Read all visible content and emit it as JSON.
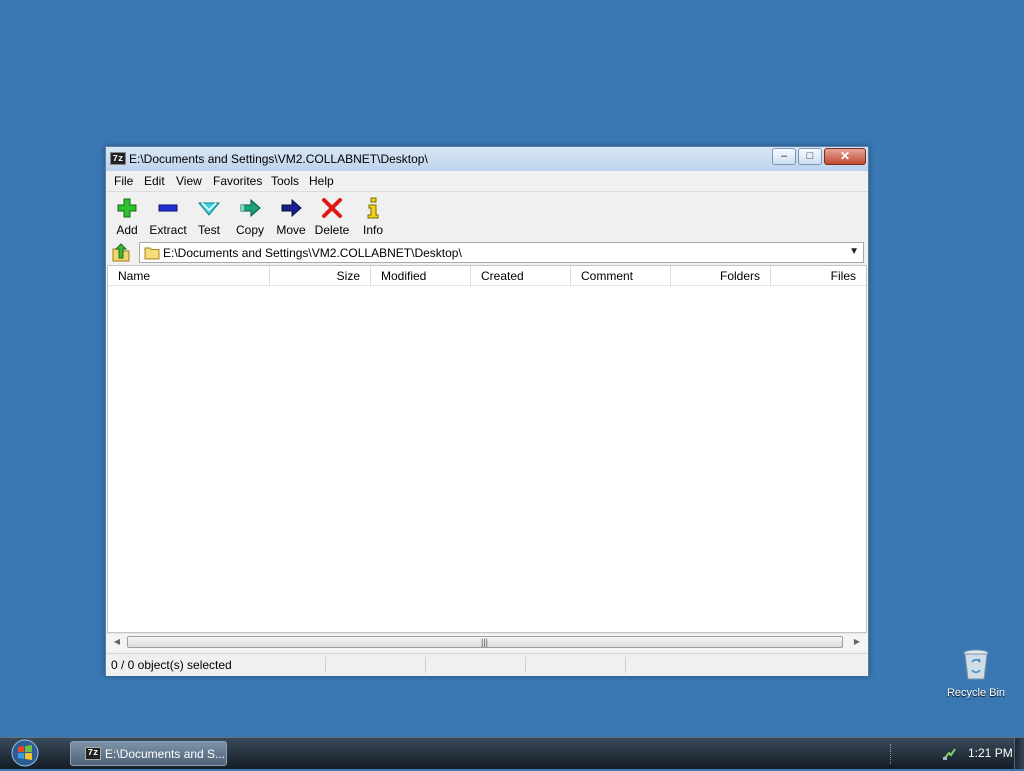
{
  "window": {
    "title": "E:\\Documents and Settings\\VM2.COLLABNET\\Desktop\\",
    "app_icon_text": "7z",
    "controls": {
      "minimize": "‒",
      "maximize": "□",
      "close": "✕"
    }
  },
  "menu": [
    "File",
    "Edit",
    "View",
    "Favorites",
    "Tools",
    "Help"
  ],
  "toolbar": [
    {
      "label": "Add",
      "icon": "add-icon"
    },
    {
      "label": "Extract",
      "icon": "extract-icon"
    },
    {
      "label": "Test",
      "icon": "test-icon"
    },
    {
      "label": "Copy",
      "icon": "copy-icon"
    },
    {
      "label": "Move",
      "icon": "move-icon"
    },
    {
      "label": "Delete",
      "icon": "delete-icon"
    },
    {
      "label": "Info",
      "icon": "info-icon"
    }
  ],
  "address": {
    "path": "E:\\Documents and Settings\\VM2.COLLABNET\\Desktop\\",
    "dropdown": "▼"
  },
  "columns": [
    "Name",
    "Size",
    "Modified",
    "Created",
    "Comment",
    "Folders",
    "Files"
  ],
  "scrollbar": {
    "left_arrow": "◀",
    "right_arrow": "▶",
    "grip": "|||"
  },
  "status": {
    "selection": "0 / 0 object(s) selected"
  },
  "desktop": {
    "recycle_bin": "Recycle Bin"
  },
  "taskbar": {
    "task_label": "E:\\Documents and S...",
    "task_icon_text": "7z",
    "clock": "1:21 PM"
  }
}
